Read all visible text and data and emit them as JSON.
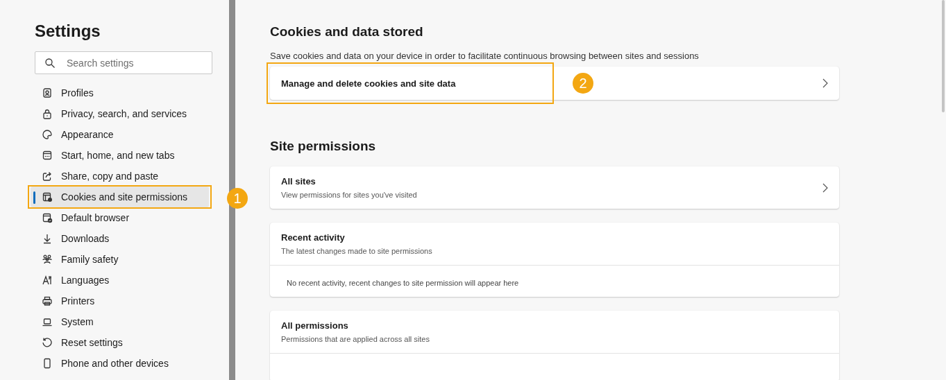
{
  "sidebar": {
    "title": "Settings",
    "search": {
      "placeholder": "Search settings"
    },
    "items": [
      {
        "label": "Profiles",
        "selected": false
      },
      {
        "label": "Privacy, search, and services",
        "selected": false
      },
      {
        "label": "Appearance",
        "selected": false
      },
      {
        "label": "Start, home, and new tabs",
        "selected": false
      },
      {
        "label": "Share, copy and paste",
        "selected": false
      },
      {
        "label": "Cookies and site permissions",
        "selected": true,
        "annotation": "1"
      },
      {
        "label": "Default browser",
        "selected": false
      },
      {
        "label": "Downloads",
        "selected": false
      },
      {
        "label": "Family safety",
        "selected": false
      },
      {
        "label": "Languages",
        "selected": false
      },
      {
        "label": "Printers",
        "selected": false
      },
      {
        "label": "System",
        "selected": false
      },
      {
        "label": "Reset settings",
        "selected": false
      },
      {
        "label": "Phone and other devices",
        "selected": false
      }
    ]
  },
  "main": {
    "sections": [
      {
        "title": "Cookies and data stored",
        "description": "Save cookies and data on your device in order to facilitate continuous browsing between sites and sessions",
        "cards": [
          {
            "kind": "link",
            "title": "Manage and delete cookies and site data",
            "annotation": "2"
          }
        ]
      },
      {
        "title": "Site permissions",
        "cards": [
          {
            "kind": "link",
            "title": "All sites",
            "subtitle": "View permissions for sites you've visited"
          },
          {
            "kind": "info",
            "title": "Recent activity",
            "subtitle": "The latest changes made to site permissions",
            "body": "No recent activity, recent changes to site permission will appear here"
          },
          {
            "kind": "group",
            "title": "All permissions",
            "subtitle": "Permissions that are applied across all sites"
          }
        ]
      }
    ]
  }
}
